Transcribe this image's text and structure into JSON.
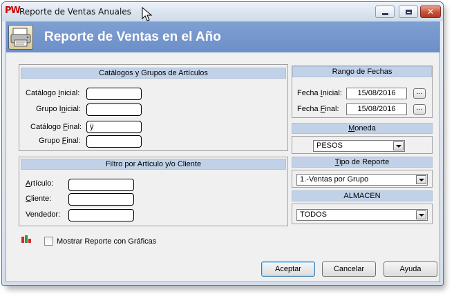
{
  "window": {
    "logo_text": "PW",
    "title": "Reporte de Ventas Anuales",
    "close_symbol": "✕"
  },
  "header": {
    "title": "Reporte de Ventas en el Año"
  },
  "catalogos": {
    "title": "Catálogos y Grupos de Artículos",
    "catalogo_inicial_label": "Catálogo Inicial:",
    "catalogo_inicial_value": "",
    "grupo_inicial_label": "Grupo Inicial:",
    "grupo_inicial_value": "",
    "catalogo_final_label": "Catálogo Final:",
    "catalogo_final_value": "ÿ",
    "grupo_final_label": "Grupo Final:",
    "grupo_final_value": ""
  },
  "filtro": {
    "title": "Filtro por Artículo  y/o Cliente",
    "articulo_label": "Artículo:",
    "articulo_value": "",
    "cliente_label": "Cliente:",
    "cliente_value": "",
    "vendedor_label": "Vendedor:",
    "vendedor_value": ""
  },
  "rango": {
    "title": "Rango de Fechas",
    "fecha_inicial_label": "Fecha Inicial:",
    "fecha_inicial_value": "15/08/2016",
    "fecha_final_label": "Fecha Final:",
    "fecha_final_value": "15/08/2016",
    "picker_label": "..."
  },
  "moneda": {
    "title": "Moneda",
    "selected": "PESOS"
  },
  "tipo_reporte": {
    "title": "Tipo de Reporte",
    "selected": "1.-Ventas por Grupo"
  },
  "almacen": {
    "title": "ALMACEN",
    "selected": "TODOS"
  },
  "graficas": {
    "label": "Mostrar Reporte con Gráficas",
    "checked": false
  },
  "buttons": {
    "aceptar": "Aceptar",
    "cancelar": "Cancelar",
    "ayuda": "Ayuda"
  },
  "colors": {
    "header_blue": "#7393cc",
    "band_blue": "#c1d2e8",
    "close_red": "#c5523a",
    "logo_red": "#cc0000"
  }
}
